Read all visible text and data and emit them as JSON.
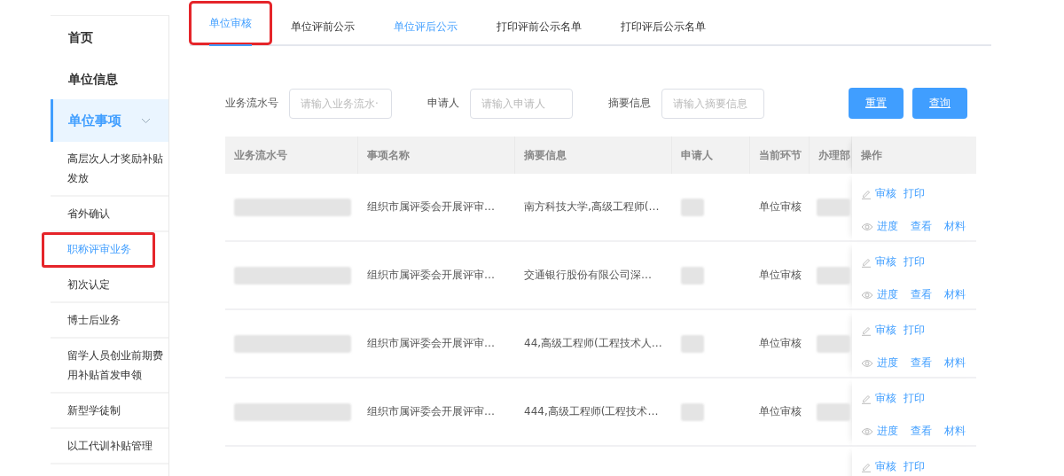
{
  "sidebar": {
    "items": [
      {
        "label": "首页",
        "kind": "top",
        "selected": false,
        "highlighted": false
      },
      {
        "label": "单位信息",
        "kind": "top",
        "selected": false,
        "highlighted": false
      },
      {
        "label": "单位事项",
        "kind": "group",
        "selected": true,
        "expanded": true,
        "highlighted": false
      },
      {
        "label": "高层次人才奖励补贴发放",
        "kind": "sub",
        "selected": false,
        "highlighted": false
      },
      {
        "label": "省外确认",
        "kind": "sub",
        "selected": false,
        "highlighted": false
      },
      {
        "label": "职称评审业务",
        "kind": "sub",
        "selected": true,
        "highlighted": true
      },
      {
        "label": "初次认定",
        "kind": "sub",
        "selected": false,
        "highlighted": false
      },
      {
        "label": "博士后业务",
        "kind": "sub",
        "selected": false,
        "highlighted": false
      },
      {
        "label": "留学人员创业前期费用补贴首发申领",
        "kind": "sub",
        "selected": false,
        "highlighted": false
      },
      {
        "label": "新型学徒制",
        "kind": "sub",
        "selected": false,
        "highlighted": false
      },
      {
        "label": "以工代训补贴管理",
        "kind": "sub",
        "selected": false,
        "highlighted": false
      }
    ]
  },
  "tabs": [
    {
      "label": "单位审核",
      "selected": true,
      "hovered": false,
      "highlighted": true
    },
    {
      "label": "单位评前公示",
      "selected": false,
      "hovered": false,
      "highlighted": false
    },
    {
      "label": "单位评后公示",
      "selected": false,
      "hovered": true,
      "highlighted": false
    },
    {
      "label": "打印评前公示名单",
      "selected": false,
      "hovered": false,
      "highlighted": false
    },
    {
      "label": "打印评后公示名单",
      "selected": false,
      "hovered": false,
      "highlighted": false
    }
  ],
  "filters": [
    {
      "label": "业务流水号",
      "placeholder": "请输入业务流水·"
    },
    {
      "label": "申请人",
      "placeholder": "请输入申请人"
    },
    {
      "label": "摘要信息",
      "placeholder": "请输入摘要信息"
    }
  ],
  "buttons": [
    "重置",
    "查询"
  ],
  "table": {
    "columns": [
      "业务流水号",
      "事项名称",
      "摘要信息",
      "申请人",
      "当前环节",
      "办理部",
      "操作"
    ],
    "rows": [
      {
        "name": "组织市属评委会开展评审…",
        "summary": "南方科技大学,高级工程师(…",
        "stage": "单位审核",
        "actions_top": [
          "审核",
          "打印"
        ],
        "actions_bottom": [
          "进度",
          "查看",
          "材料"
        ]
      },
      {
        "name": "组织市属评委会开展评审…",
        "summary": "交通银行股份有限公司深…",
        "stage": "单位审核",
        "actions_top": [
          "审核",
          "打印"
        ],
        "actions_bottom": [
          "进度",
          "查看",
          "材料"
        ]
      },
      {
        "name": "组织市属评委会开展评审…",
        "summary": "44,高级工程师(工程技术人…",
        "stage": "单位审核",
        "actions_top": [
          "审核",
          "打印"
        ],
        "actions_bottom": [
          "进度",
          "查看",
          "材料"
        ]
      },
      {
        "name": "组织市属评委会开展评审…",
        "summary": "444,高级工程师(工程技术…",
        "stage": "单位审核",
        "actions_top": [
          "审核",
          "打印"
        ],
        "actions_bottom": [
          "进度",
          "查看",
          "材料"
        ]
      },
      {
        "actions_top": [
          "审核",
          "打印"
        ]
      }
    ]
  }
}
